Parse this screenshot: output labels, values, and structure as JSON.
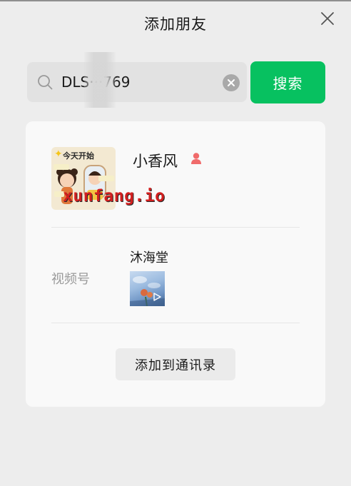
{
  "window": {
    "title": "添加朋友"
  },
  "search": {
    "value": "DLS···769",
    "placeholder": "",
    "button_label": "搜索"
  },
  "result": {
    "nickname": "小香风",
    "gender": "female",
    "avatar_caption": "今天开始",
    "watermark": "xunfang.io",
    "channel": {
      "label": "视频号",
      "name": "沐海堂"
    },
    "add_button_label": "添加到通讯录"
  },
  "colors": {
    "accent": "#07c160",
    "background": "#ededed",
    "card": "#f9f9f9",
    "female_icon": "#f06b6b"
  }
}
